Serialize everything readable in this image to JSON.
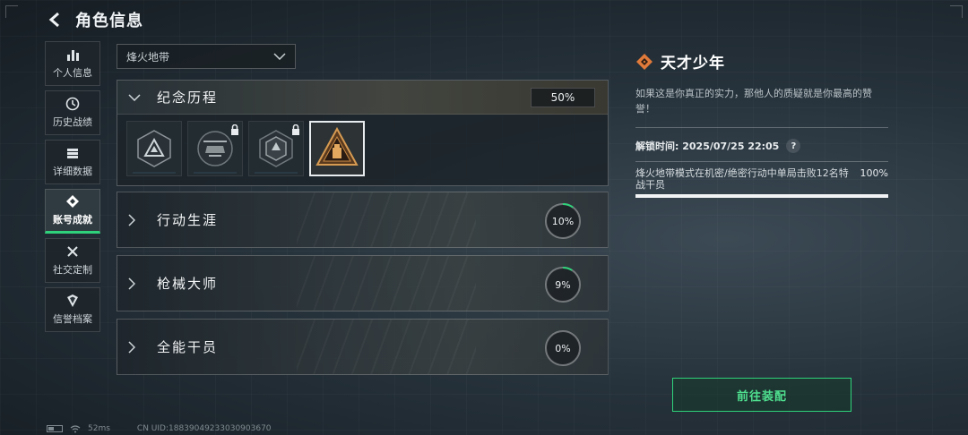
{
  "header": {
    "title": "角色信息"
  },
  "sidebar": {
    "items": [
      {
        "label": "个人信息",
        "icon": "bar-chart-icon",
        "active": false
      },
      {
        "label": "历史战绩",
        "icon": "history-icon",
        "active": false
      },
      {
        "label": "详细数据",
        "icon": "stack-icon",
        "active": false
      },
      {
        "label": "账号成就",
        "icon": "achievement-icon",
        "active": true
      },
      {
        "label": "社交定制",
        "icon": "tools-icon",
        "active": false
      },
      {
        "label": "信誉档案",
        "icon": "reputation-icon",
        "active": false
      }
    ]
  },
  "mode_select": {
    "value": "烽火地带"
  },
  "categories": {
    "memorial": {
      "name": "纪念历程",
      "percent": "50%",
      "progress": 0.5
    },
    "badges": [
      {
        "icon": "triangle-emblem-icon",
        "locked": false,
        "selected": false
      },
      {
        "icon": "helicopter-emblem-icon",
        "locked": true,
        "selected": false
      },
      {
        "icon": "hex-emblem-icon",
        "locked": true,
        "selected": false
      },
      {
        "icon": "gold-triangle-emblem-icon",
        "locked": false,
        "selected": true
      }
    ],
    "items": [
      {
        "name": "行动生涯",
        "percent": "10%",
        "progress": 0.1
      },
      {
        "name": "枪械大师",
        "percent": "9%",
        "progress": 0.09
      },
      {
        "name": "全能干员",
        "percent": "0%",
        "progress": 0.0
      }
    ]
  },
  "detail": {
    "title": "天才少年",
    "description": "如果这是你真正的实力，那他人的质疑就是你最高的赞誉！",
    "unlock_time": "解锁时间: 2025/07/25 22:05",
    "help": "?",
    "condition": "烽火地带模式在机密/绝密行动中单局击败12名特战干员",
    "condition_percent": "100%",
    "condition_progress": 1.0
  },
  "equip_button": "前往装配",
  "footer": {
    "ping": "52ms",
    "uid": "CN UID:18839049233030903670"
  },
  "colors": {
    "accent_green": "#2fd27a",
    "badge_orange": "#e07a3a"
  }
}
